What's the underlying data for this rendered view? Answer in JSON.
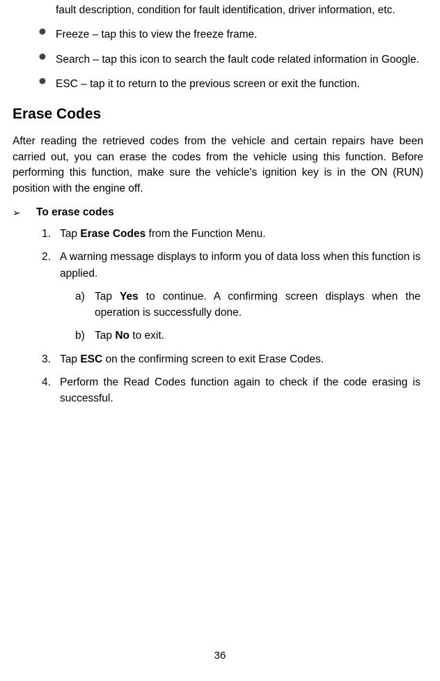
{
  "continuation": "fault description, condition for fault identification, driver information, etc.",
  "bullets": [
    "Freeze – tap this to view the freeze frame.",
    "Search – tap this icon to search the fault code related information in Google.",
    "ESC – tap it to return to the previous screen or exit the function."
  ],
  "heading": "Erase Codes",
  "intro_paragraph": "After reading the retrieved codes from the vehicle and certain repairs have been carried out, you can erase the codes from the vehicle using this function. Before performing this function, make sure the vehicle's ignition key is in the ON (RUN) position with the engine off.",
  "procedure_title": "To erase codes",
  "steps": {
    "s1_pre": "Tap ",
    "s1_bold": "Erase Codes",
    "s1_post": " from the Function Menu.",
    "s2": "A warning message displays to inform you of data loss when this function is applied.",
    "s2a_pre": "Tap ",
    "s2a_bold": "Yes",
    "s2a_post": " to continue. A confirming screen displays when the operation is successfully done.",
    "s2b_pre": "Tap ",
    "s2b_bold": "No",
    "s2b_post": " to exit.",
    "s3_pre": "Tap ",
    "s3_bold": "ESC",
    "s3_post": " on the confirming screen to exit Erase Codes.",
    "s4": "Perform the Read Codes function again to check if the code erasing is successful."
  },
  "page_number": "36"
}
